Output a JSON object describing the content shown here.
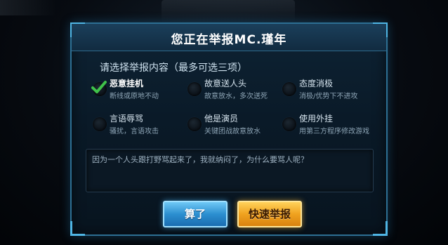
{
  "dialog": {
    "title": "您正在举报MC.瑾年",
    "section_label": "请选择举报内容（最多可选三项）",
    "options": [
      {
        "name": "恶意挂机",
        "desc": "断线或原地不动",
        "selected": true
      },
      {
        "name": "故意送人头",
        "desc": "故意放水，多次送死",
        "selected": false
      },
      {
        "name": "态度消极",
        "desc": "消极/优势下不进攻",
        "selected": false
      },
      {
        "name": "言语辱骂",
        "desc": "骚扰，言语攻击",
        "selected": false
      },
      {
        "name": "他是演员",
        "desc": "关键团战故意放水",
        "selected": false
      },
      {
        "name": "使用外挂",
        "desc": "用第三方程序修改游戏",
        "selected": false
      }
    ],
    "comment_text": "因为一个人头跟打野骂起来了，我就纳闷了，为什么要骂人呢？",
    "cancel_label": "算了",
    "report_label": "快速举报"
  },
  "colors": {
    "accent_blue": "#2d6f93",
    "cancel_button": "#2c8fd0",
    "report_button": "#f0a21f",
    "check_green": "#3fc24a"
  }
}
